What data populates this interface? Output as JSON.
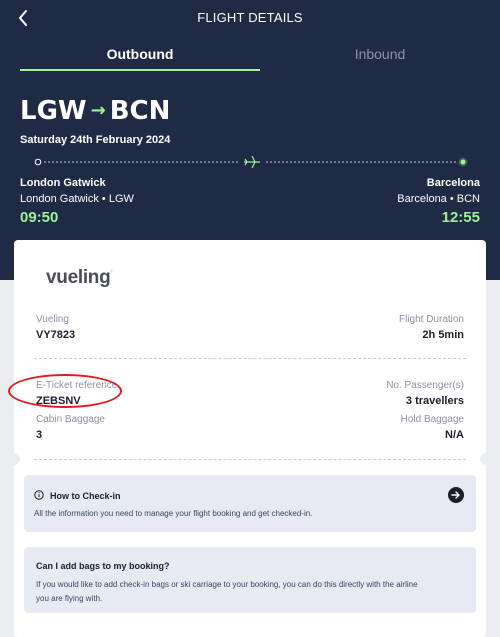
{
  "header": {
    "title": "FLIGHT DETAILS",
    "tabs": [
      {
        "label": "Outbound",
        "active": true
      },
      {
        "label": "Inbound",
        "active": false
      }
    ],
    "accent_color": "#9ff29a",
    "background_color": "#1f2a44"
  },
  "flight": {
    "origin_code": "LGW",
    "destination_code": "BCN",
    "arrow": "→",
    "date": "Saturday 24th February 2024",
    "origin_city": "London Gatwick",
    "origin_airport": "London Gatwick • LGW",
    "departure_time": "09:50",
    "destination_city": "Barcelona",
    "destination_airport": "Barcelona • BCN",
    "arrival_time": "12:55"
  },
  "details": {
    "airline_logo": "vueling",
    "airline_logo_mark": "·",
    "airline_label": "Vueling",
    "flight_number": "VY7823",
    "duration_label": "Flight Duration",
    "duration_value": "2h 5min",
    "eticket_label": "E-Ticket reference",
    "eticket_value": "ZEBSNV",
    "passengers_label": "No. Passenger(s)",
    "passengers_value": "3 travellers",
    "cabin_label": "Cabin Baggage",
    "cabin_value": "3",
    "hold_label": "Hold Baggage",
    "hold_value": "N/A"
  },
  "checkin": {
    "title": "How to Check-in",
    "text": "All the information you need to manage your flight booking and get checked-in.",
    "icon": "info-icon",
    "action_icon": "arrow-right-circle-icon"
  },
  "bags": {
    "title": "Can I add bags to my booking?",
    "text_line1": "If you would like to add check-in bags or ski carriage to your booking, you can do this directly with the airline",
    "text_line2": "you are flying with."
  },
  "annotation": {
    "color": "#e21b1b"
  }
}
